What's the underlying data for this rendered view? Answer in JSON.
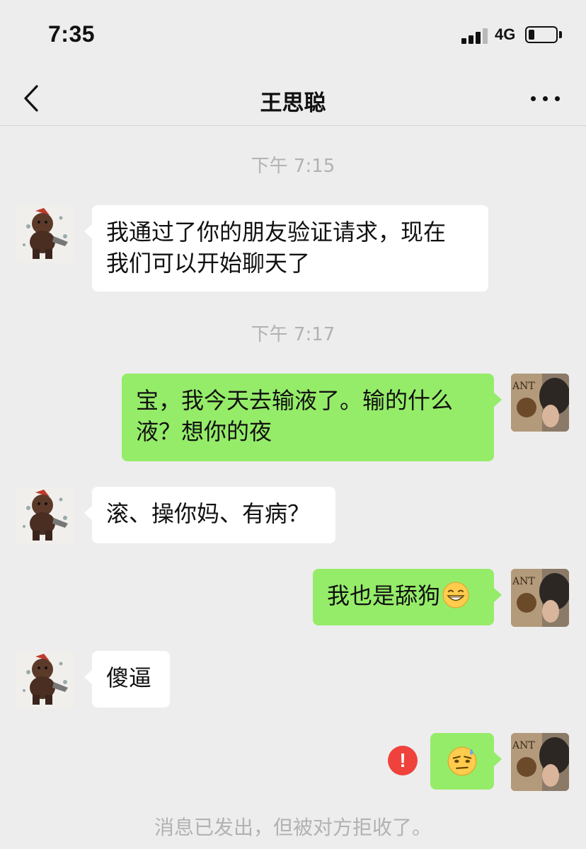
{
  "status_bar": {
    "time": "7:35",
    "network": "4G",
    "battery_level": 0.15
  },
  "nav": {
    "title": "王思聪",
    "back_icon": "chevron-left-icon",
    "more_icon": "ellipsis-icon"
  },
  "messages": [
    {
      "type": "time",
      "text": "下午 7:15"
    },
    {
      "type": "incoming",
      "lines": [
        "我通过了你的朋友验证请求，现在",
        "我们可以开始聊天了"
      ]
    },
    {
      "type": "time",
      "text": "下午 7:17"
    },
    {
      "type": "outgoing",
      "lines": [
        "宝，我今天去输液了。输的什么",
        "液？想你的夜"
      ]
    },
    {
      "type": "incoming",
      "lines": [
        "滚、操你妈、有病？"
      ]
    },
    {
      "type": "outgoing",
      "lines": [
        "我也是舔狗"
      ],
      "trailing_emoji": "grinning-teeth-emoji"
    },
    {
      "type": "incoming",
      "lines": [
        "傻逼"
      ]
    },
    {
      "type": "outgoing",
      "emoji": "cold-sweat-emoji",
      "status_icon": "exclamation-error-icon"
    }
  ],
  "system_notice": "消息已发出，但被对方拒收了。",
  "colors": {
    "background": "#ededed",
    "outgoing_bubble": "#95ec69",
    "incoming_bubble": "#ffffff",
    "error": "#f0423c",
    "muted_text": "#b2b2b2"
  }
}
